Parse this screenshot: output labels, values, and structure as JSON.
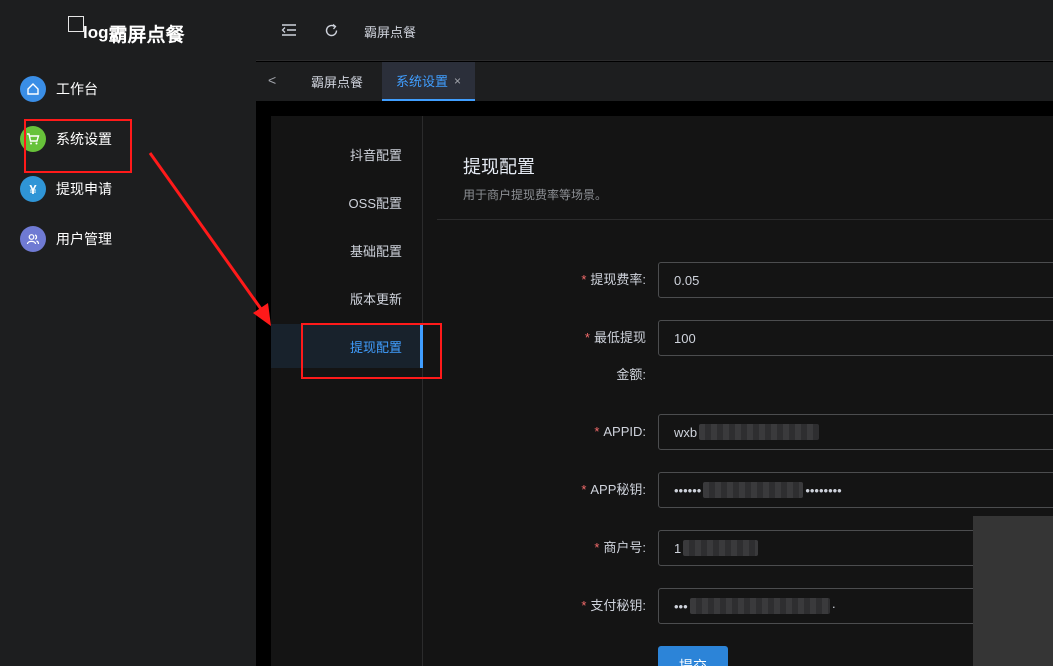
{
  "app": {
    "logo_alt": "log",
    "logo_text": "霸屏点餐"
  },
  "sidebar": {
    "items": [
      {
        "label": "工作台",
        "icon": "home-icon",
        "color": "#3a8ee6"
      },
      {
        "label": "系统设置",
        "icon": "cart-icon",
        "color": "#67c23a"
      },
      {
        "label": "提现申请",
        "icon": "yen-icon",
        "color": "#2f95d6"
      },
      {
        "label": "用户管理",
        "icon": "users-icon",
        "color": "#6f7ad3"
      }
    ]
  },
  "topbar": {
    "title": "霸屏点餐"
  },
  "tabs": [
    {
      "label": "霸屏点餐"
    },
    {
      "label": "系统设置",
      "close": "×"
    }
  ],
  "submenu": {
    "items": [
      {
        "label": "抖音配置"
      },
      {
        "label": "OSS配置"
      },
      {
        "label": "基础配置"
      },
      {
        "label": "版本更新"
      },
      {
        "label": "提现配置"
      }
    ]
  },
  "content": {
    "title": "提现配置",
    "description": "用于商户提现费率等场景。"
  },
  "form": {
    "fields": [
      {
        "label": "提现费率:",
        "value": "0.05"
      },
      {
        "label_line1": "最低提现",
        "label_line2": "金额:",
        "value": "100"
      },
      {
        "label": "APPID:",
        "value": "wxb"
      },
      {
        "label": "APP秘钥:",
        "value": "••••••",
        "value_tail": "••••••••"
      },
      {
        "label": "商户号:",
        "value": "1"
      },
      {
        "label": "支付秘钥:",
        "value": "•••",
        "value_tail": "·"
      }
    ],
    "required_mark": "*",
    "submit_label": "提交"
  },
  "colors": {
    "accent": "#409eff",
    "annotation": "#ff1a1a"
  }
}
